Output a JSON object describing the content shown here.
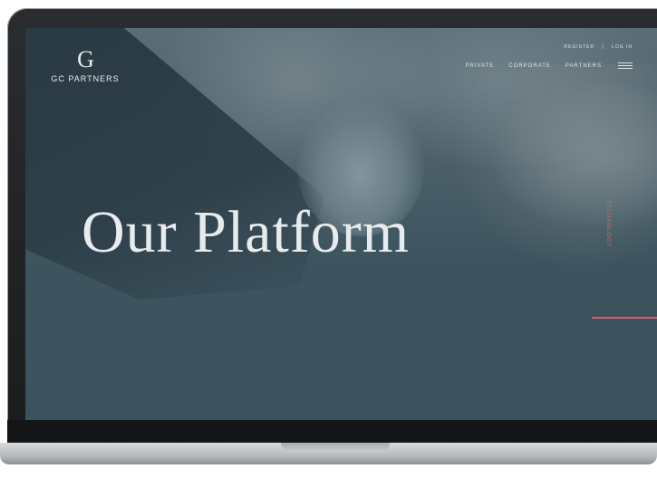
{
  "brand": {
    "mark": "G",
    "name": "GC PARTNERS"
  },
  "top_links": {
    "register": "REGISTER",
    "separator": "|",
    "login": "LOG IN"
  },
  "nav": {
    "items": [
      "PRIVATE",
      "CORPORATE",
      "PARTNERS"
    ]
  },
  "hero": {
    "title": "Our Platform",
    "side_label": "TECHNOLOGY"
  },
  "colors": {
    "background": "#3c525e",
    "accent": "#e0576a",
    "text": "#e7ebed"
  },
  "icons": [
    "hamburger-menu-icon"
  ]
}
